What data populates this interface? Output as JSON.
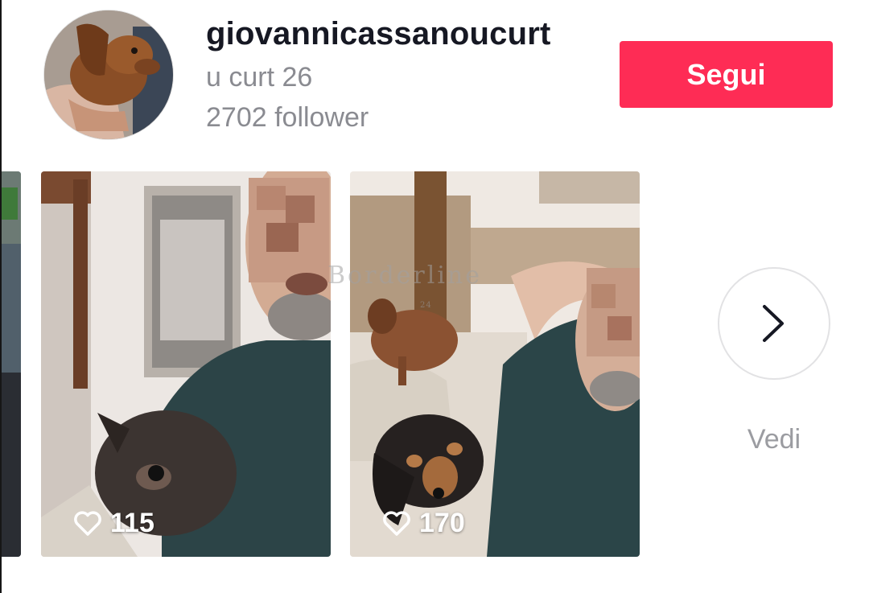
{
  "profile": {
    "username": "giovannicassanoucurt",
    "nickname": "u curt 26",
    "followers": "2702 follower",
    "follow_label": "Segui"
  },
  "videos": [
    {
      "likes": "115",
      "icon": "heart-outline-icon"
    },
    {
      "likes": "170",
      "icon": "heart-outline-icon"
    }
  ],
  "watermark": {
    "text": "Borderline",
    "number": "24"
  },
  "see_more": {
    "label": "Vedi",
    "icon": "chevron-right-icon"
  },
  "colors": {
    "accent": "#fe2c55",
    "primary_text": "#161823",
    "secondary_text": "#8a8b91"
  }
}
